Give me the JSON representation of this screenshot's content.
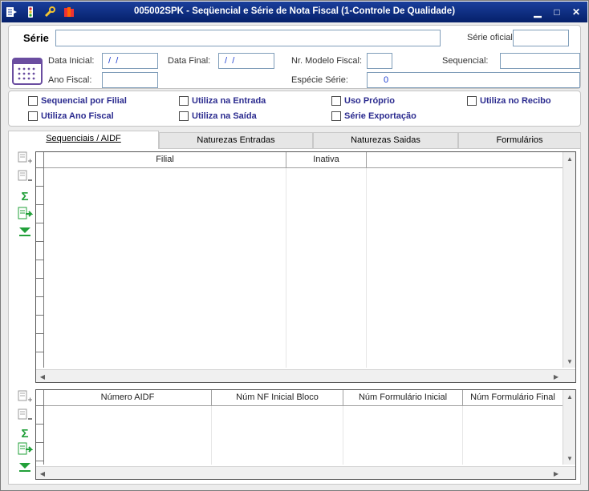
{
  "window": {
    "title": "005002SPK - Seqüencial e Série de Nota Fiscal (1-Controle De Qualidade)"
  },
  "header": {
    "serie_label": "Série",
    "serie_value": "",
    "serie_oficial_label": "Série oficial",
    "serie_oficial_value": "",
    "data_inicial_label": "Data Inicial:",
    "data_inicial_value": " /  /",
    "data_final_label": "Data Final:",
    "data_final_value": " /  /",
    "nr_modelo_label": "Nr. Modelo Fiscal:",
    "nr_modelo_value": "",
    "sequencial_label": "Sequencial:",
    "sequencial_value": "",
    "ano_fiscal_label": "Ano Fiscal:",
    "ano_fiscal_value": "",
    "especie_label": "Espécie Série:",
    "especie_value": "0"
  },
  "options": {
    "sequencial_por_filial": "Sequencial por Filial",
    "utiliza_na_entrada": "Utiliza na Entrada",
    "uso_proprio": "Uso Próprio",
    "utiliza_no_recibo": "Utiliza no Recibo",
    "utiliza_ano_fiscal": "Utiliza Ano Fiscal",
    "utiliza_na_saida": "Utiliza na Saída",
    "serie_exportacao": "Série Exportação"
  },
  "tabs": [
    {
      "label": "Sequenciais / AIDF"
    },
    {
      "label": "Naturezas Entradas"
    },
    {
      "label": "Naturezas Saidas"
    },
    {
      "label": "Formulários"
    }
  ],
  "grid1": {
    "columns": [
      "Filial",
      "Inativa"
    ]
  },
  "grid2": {
    "columns": [
      "Número AIDF",
      "Núm NF Inicial Bloco",
      "Núm Formulário Inicial",
      "Núm Formulário Final"
    ]
  },
  "colors": {
    "title_bar": "#0a246a",
    "checkbox_label": "#2b2b8f",
    "field_border": "#7f9db9"
  }
}
